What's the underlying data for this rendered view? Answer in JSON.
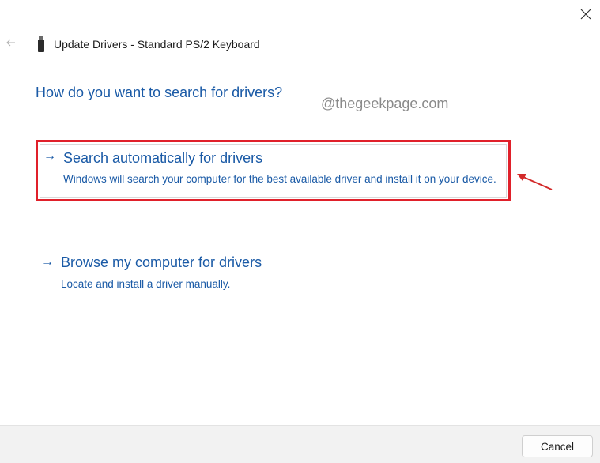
{
  "window": {
    "title": "Update Drivers - Standard PS/2 Keyboard",
    "close_icon": "close-icon",
    "back_icon": "back-arrow-icon",
    "device_icon": "usb-device-icon"
  },
  "main": {
    "question": "How do you want to search for drivers?",
    "watermark": "@thegeekpage.com",
    "options": [
      {
        "arrow": "→",
        "title": "Search automatically for drivers",
        "description": "Windows will search your computer for the best available driver and install it on your device."
      },
      {
        "arrow": "→",
        "title": "Browse my computer for drivers",
        "description": "Locate and install a driver manually."
      }
    ]
  },
  "footer": {
    "cancel_label": "Cancel"
  },
  "colors": {
    "link_blue": "#1a5aa6",
    "highlight_red": "#e0202a",
    "footer_bg": "#f2f2f2"
  }
}
